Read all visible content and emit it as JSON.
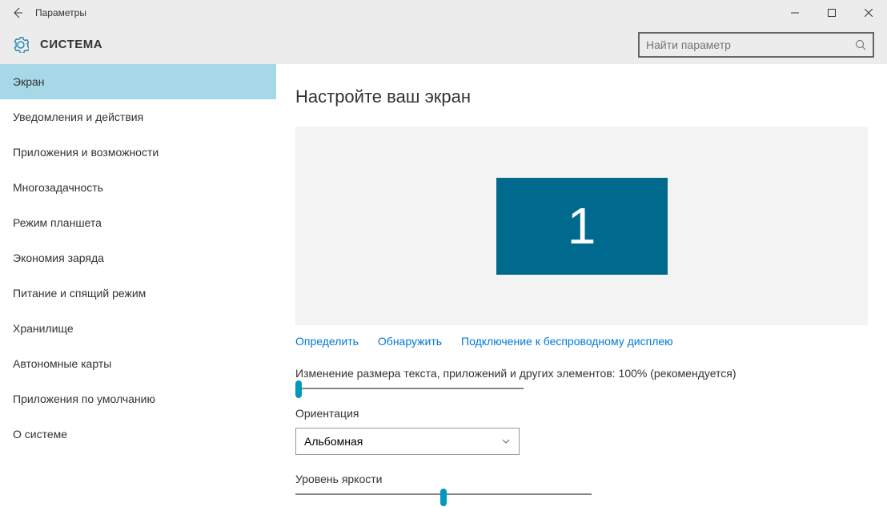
{
  "titlebar": {
    "title": "Параметры"
  },
  "header": {
    "title": "СИСТЕМА",
    "search_placeholder": "Найти параметр"
  },
  "sidebar": {
    "items": [
      {
        "label": "Экран",
        "active": true
      },
      {
        "label": "Уведомления и действия",
        "active": false
      },
      {
        "label": "Приложения и возможности",
        "active": false
      },
      {
        "label": "Многозадачность",
        "active": false
      },
      {
        "label": "Режим планшета",
        "active": false
      },
      {
        "label": "Экономия заряда",
        "active": false
      },
      {
        "label": "Питание и спящий режим",
        "active": false
      },
      {
        "label": "Хранилище",
        "active": false
      },
      {
        "label": "Автономные карты",
        "active": false
      },
      {
        "label": "Приложения по умолчанию",
        "active": false
      },
      {
        "label": "О системе",
        "active": false
      }
    ]
  },
  "main": {
    "title": "Настройте ваш экран",
    "monitor_number": "1",
    "links": {
      "identify": "Определить",
      "detect": "Обнаружить",
      "wireless": "Подключение к беспроводному дисплею"
    },
    "scale_label": "Изменение размера текста, приложений и других элементов: 100% (рекомендуется)",
    "orientation_label": "Ориентация",
    "orientation_value": "Альбомная",
    "brightness_label": "Уровень яркости"
  }
}
